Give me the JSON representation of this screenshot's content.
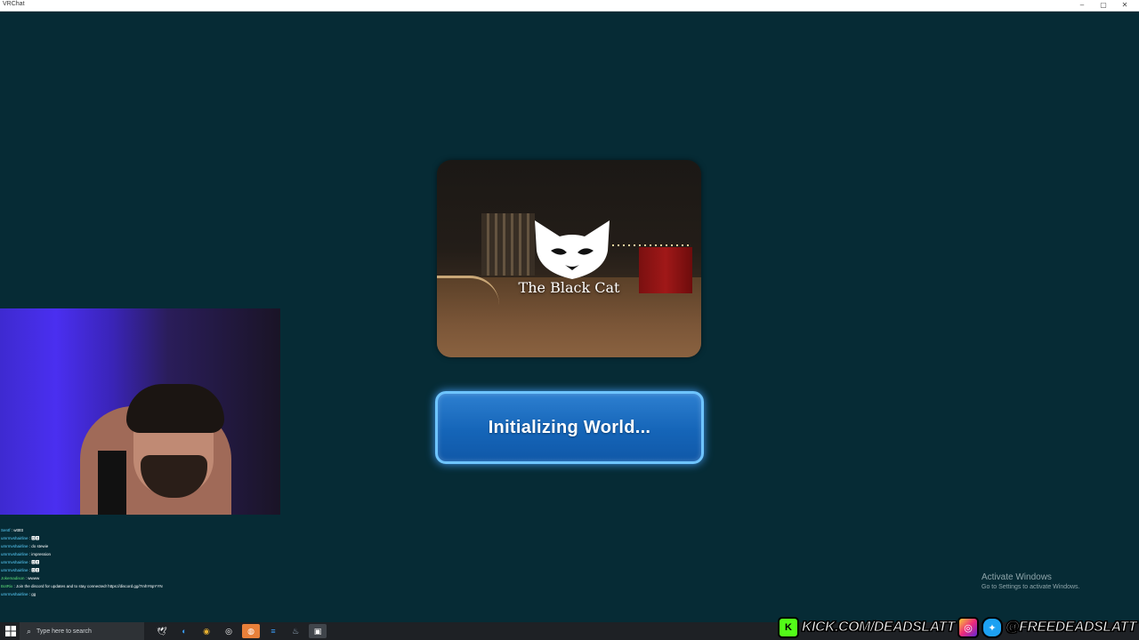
{
  "window": {
    "title": "VRChat",
    "controls": [
      "–",
      "▢",
      "✕"
    ]
  },
  "world": {
    "name": "The Black Cat",
    "logo_icon": "cat-head-icon"
  },
  "loading": {
    "label": "Initializing World..."
  },
  "chat": {
    "messages": [
      {
        "user": "Sentf",
        "text": "wtttttt"
      },
      {
        "user": "umrmvshairline",
        "text": "🅳🅳"
      },
      {
        "user": "umrmvshairline",
        "text": "do stewie"
      },
      {
        "user": "umrmvshairline",
        "text": "impression"
      },
      {
        "user": "umrmvshairline",
        "text": "🅳🅳"
      },
      {
        "user": "umrmvshairline",
        "text": "🅳🅳"
      },
      {
        "user": "Jokemadison",
        "text": "wwww"
      },
      {
        "user": "BotRix",
        "text": "Join the discord for updates and to stay connected! https://discord.gg/7mhY6pYYN"
      },
      {
        "user": "umrmvshairline",
        "text": "gg"
      }
    ]
  },
  "activate_windows": {
    "title": "Activate Windows",
    "subtitle": "Go to Settings to activate Windows."
  },
  "taskbar": {
    "search_placeholder": "Type here to search",
    "apps": [
      "pigeon-icon",
      "edge-icon",
      "chrome-icon",
      "obs-icon",
      "orange-app-icon",
      "vscode-icon",
      "steam-icon",
      "vrchat-icon"
    ]
  },
  "social": {
    "kick": "KICK.COM/DEADSLATT",
    "handle": "@FREEDEADSLATT"
  },
  "colors": {
    "background": "#062b35",
    "button_blue": "#1565b8",
    "button_glow": "#6ec4ff",
    "kick_green": "#53fc18"
  }
}
